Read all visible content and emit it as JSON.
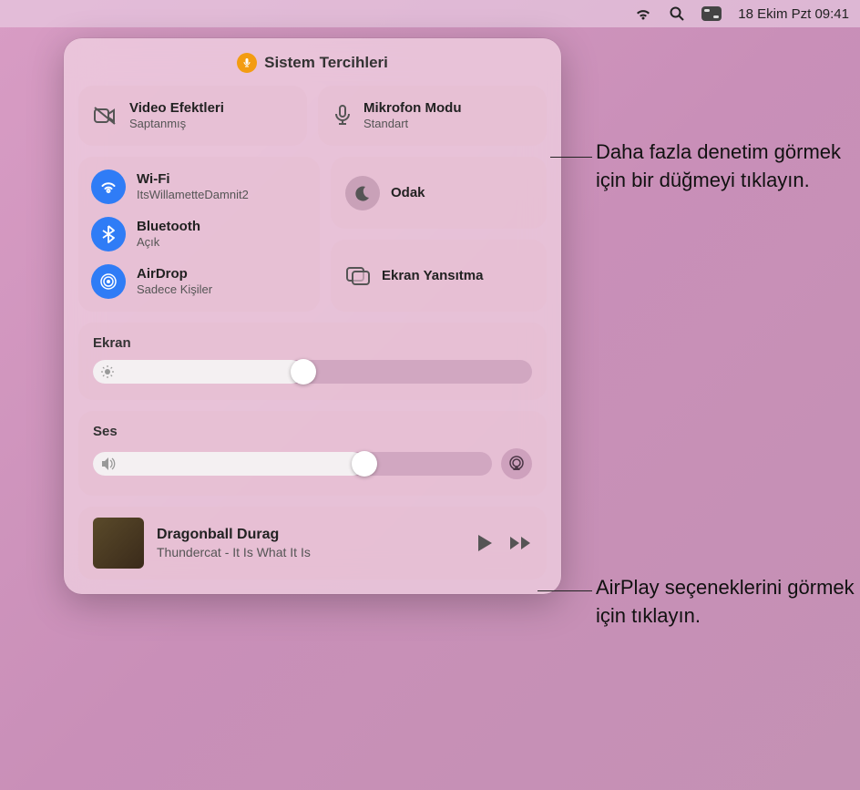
{
  "menubar": {
    "datetime": "18 Ekim Pzt  09:41"
  },
  "panel": {
    "title": "Sistem Tercihleri",
    "video_effects": {
      "label": "Video Efektleri",
      "sub": "Saptanmış"
    },
    "mic_mode": {
      "label": "Mikrofon Modu",
      "sub": "Standart"
    },
    "wifi": {
      "label": "Wi-Fi",
      "sub": "ItsWillametteDamnit2"
    },
    "bluetooth": {
      "label": "Bluetooth",
      "sub": "Açık"
    },
    "airdrop": {
      "label": "AirDrop",
      "sub": "Sadece Kişiler"
    },
    "focus": {
      "label": "Odak"
    },
    "screen_mirror": {
      "label": "Ekran Yansıtma"
    },
    "display_slider": {
      "label": "Ekran",
      "percent": 48
    },
    "sound_slider": {
      "label": "Ses",
      "percent": 68
    },
    "media": {
      "title": "Dragonball Durag",
      "subtitle": "Thundercat - It Is What It Is"
    }
  },
  "callouts": {
    "top": "Daha fazla denetim görmek için bir düğmeyi tıklayın.",
    "airplay": "AirPlay seçeneklerini görmek için tıklayın."
  }
}
